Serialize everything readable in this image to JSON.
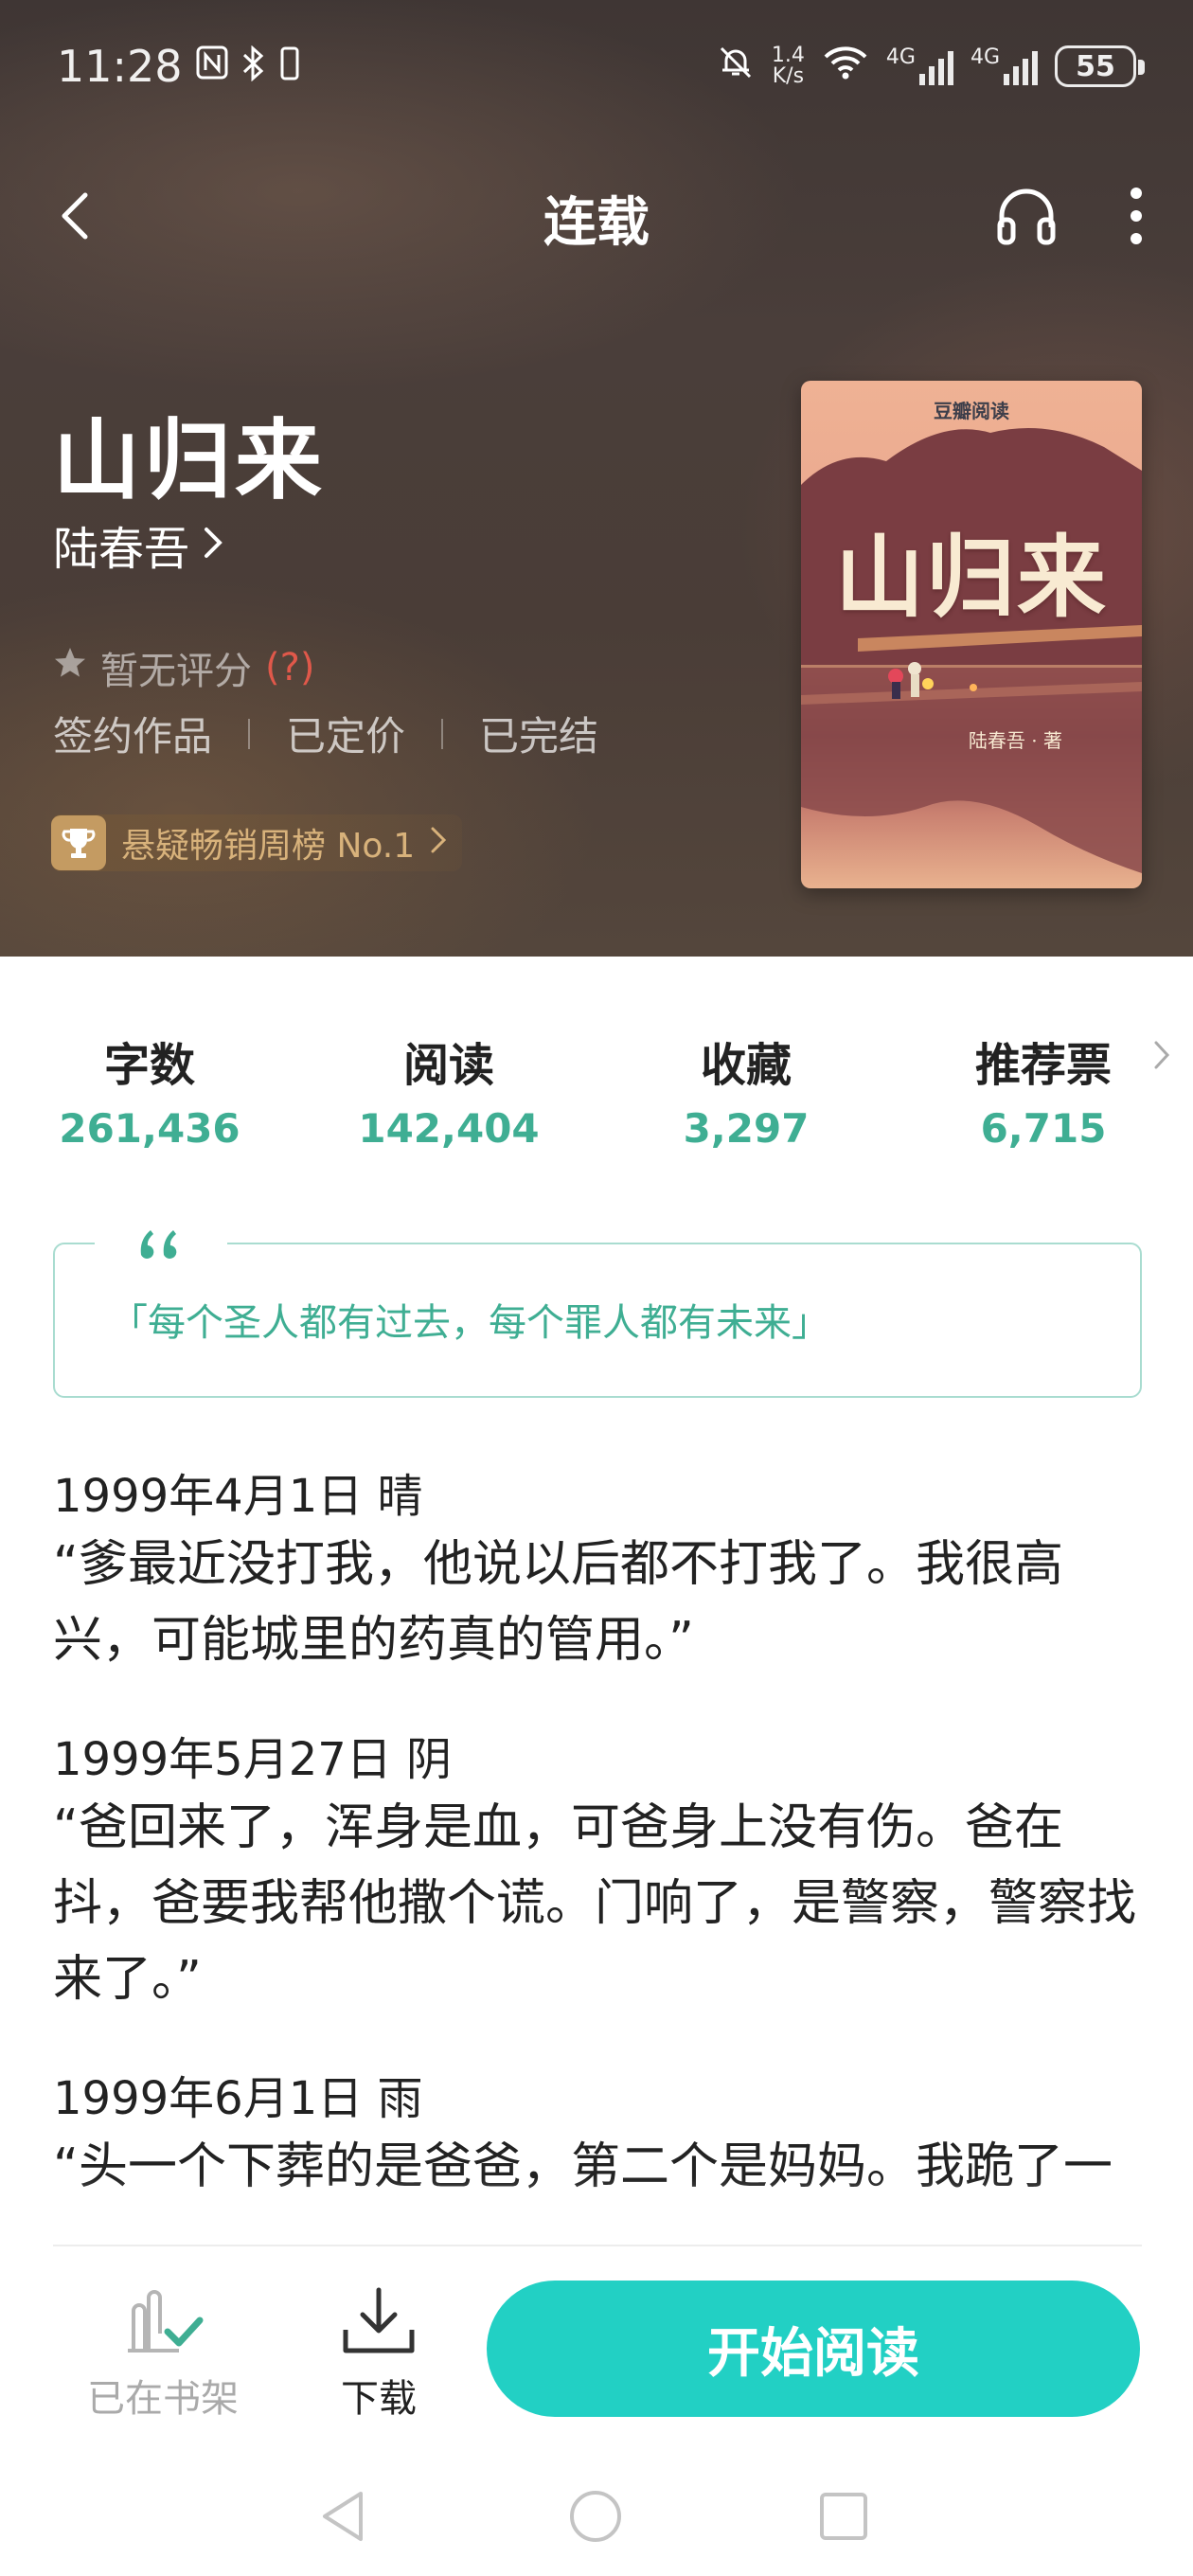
{
  "status_bar": {
    "time": "11:28",
    "speed_value": "1.4",
    "speed_unit": "K/s",
    "network_1": "4G",
    "network_2": "4G",
    "battery": "55",
    "icons": [
      "nfc-icon",
      "bluetooth-icon",
      "mute-icon",
      "wifi-icon",
      "signal-icon",
      "battery-icon"
    ]
  },
  "nav": {
    "title": "连载",
    "icons": [
      "back-icon",
      "headphones-icon",
      "more-icon"
    ]
  },
  "book": {
    "title": "山归来",
    "author": "陆春吾",
    "rating_text": "暂无评分",
    "rating_help": "(?)",
    "tags": [
      "签约作品",
      "已定价",
      "已完结"
    ],
    "rank_badge": "悬疑畅销周榜 No.1"
  },
  "cover": {
    "brand": "豆瓣阅读",
    "title": "山归来",
    "author_line": "陆春吾 · 著"
  },
  "stats": [
    {
      "label": "字数",
      "value": "261,436"
    },
    {
      "label": "阅读",
      "value": "142,404"
    },
    {
      "label": "收藏",
      "value": "3,297"
    },
    {
      "label": "推荐票",
      "value": "6,715"
    }
  ],
  "quote": "「每个圣人都有过去，每个罪人都有未来」",
  "excerpt": [
    {
      "date": "1999年4月1日 晴",
      "text": "“爹最近没打我，他说以后都不打我了。我很高兴，可能城里的药真的管用。”"
    },
    {
      "date": "1999年5月27日 阴",
      "text": "“爸回来了，浑身是血，可爸身上没有伤。爸在抖，爸要我帮他撒个谎。门响了，是警察，警察找来了。”"
    },
    {
      "date": "1999年6月1日 雨",
      "text": "“头一个下葬的是爸爸，第二个是妈妈。我跪了一"
    }
  ],
  "bottom_bar": {
    "shelf_label": "已在书架",
    "download_label": "下载",
    "start_label": "开始阅读"
  },
  "colors": {
    "accent": "#3fae93",
    "button": "#22d0c4",
    "hero_bg": "#463b37",
    "rank_gold": "#d8b27b",
    "rating_red": "#e0584a"
  }
}
